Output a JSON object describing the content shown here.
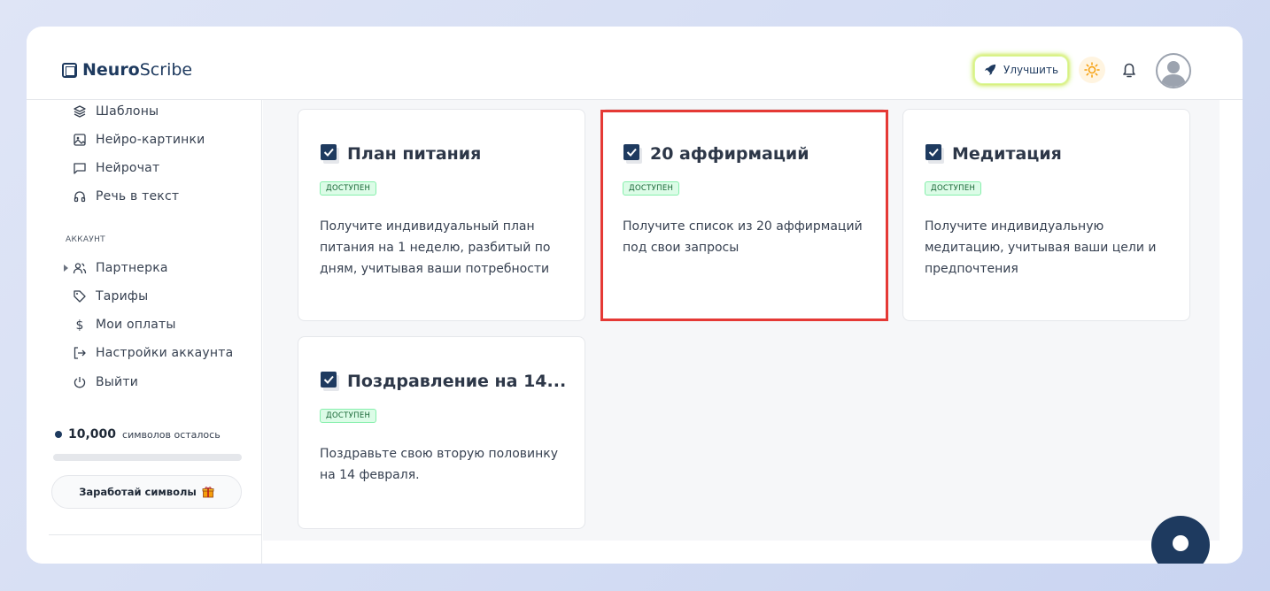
{
  "header": {
    "logo_bold": "Neuro",
    "logo_rest": "Scribe",
    "upgrade_label": "Улучшить"
  },
  "sidebar": {
    "items_top": [
      {
        "label": "Шаблоны",
        "icon": "layers-icon"
      },
      {
        "label": "Нейро-картинки",
        "icon": "image-icon"
      },
      {
        "label": "Нейрочат",
        "icon": "chat-icon"
      },
      {
        "label": "Речь в текст",
        "icon": "headphones-icon"
      }
    ],
    "section_label": "АККАУНТ",
    "items_account": [
      {
        "label": "Партнерка",
        "icon": "users-icon"
      },
      {
        "label": "Тарифы",
        "icon": "tag-icon"
      },
      {
        "label": "Мои оплаты",
        "icon": "dollar-icon"
      },
      {
        "label": "Настройки аккаунта",
        "icon": "logout-arrow-icon"
      },
      {
        "label": "Выйти",
        "icon": "power-icon"
      }
    ],
    "credits_value": "10,000",
    "credits_text": "символов осталось",
    "earn_button": "Заработай символы",
    "progress_fraction": 0.0
  },
  "cards": [
    {
      "title": "План питания",
      "badge": "ДОСТУПЕН",
      "description": "Получите индивидуальный план питания на 1 неделю, разбитый по дням, учитывая ваши потребности"
    },
    {
      "title": "20 аффирмаций",
      "badge": "ДОСТУПЕН",
      "description": "Получите список из 20 аффирмаций под свои запросы"
    },
    {
      "title": "Медитация",
      "badge": "ДОСТУПЕН",
      "description": "Получите индивидуальную медитацию, учитывая ваши цели и предпочтения"
    },
    {
      "title": "Поздравление на 14...",
      "badge": "ДОСТУПЕН",
      "description": "Поздравьте свою вторую половинку на 14 февраля."
    }
  ],
  "colors": {
    "brand": "#1e3a5f",
    "highlight": "#e53935",
    "badge_bg": "#dcfce7",
    "badge_text": "#166534"
  }
}
